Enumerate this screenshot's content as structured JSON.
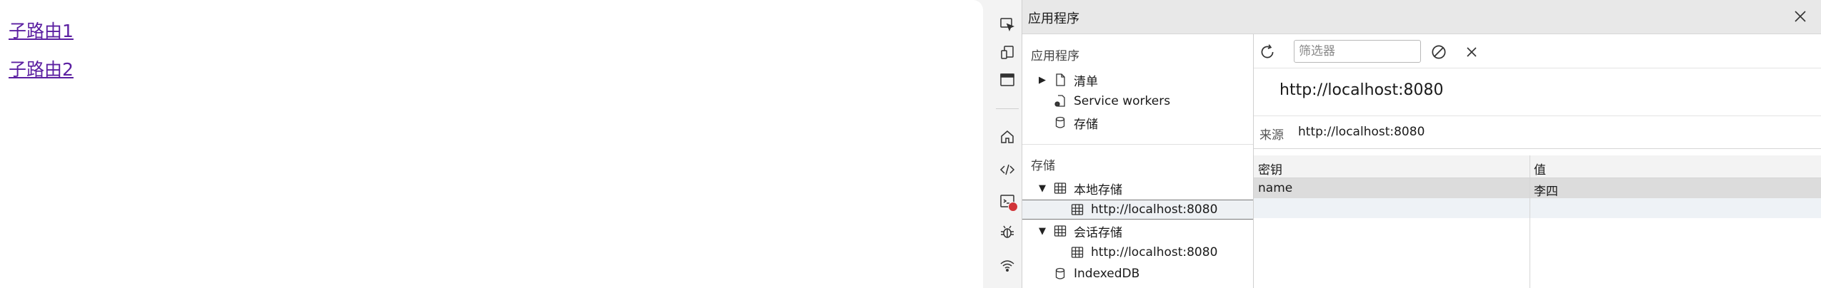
{
  "page": {
    "links": [
      "子路由1",
      "子路由2"
    ]
  },
  "devtools": {
    "title": "应用程序",
    "tree": {
      "app_section": "应用程序",
      "app_items": [
        {
          "label": "清单",
          "icon": "document-icon",
          "expandable": true
        },
        {
          "label": "Service workers",
          "icon": "gear-document-icon",
          "expandable": false
        },
        {
          "label": "存储",
          "icon": "database-icon",
          "expandable": false
        }
      ],
      "storage_section": "存储",
      "local_storage": {
        "label": "本地存储",
        "child": "http://localhost:8080"
      },
      "session_storage": {
        "label": "会话存储",
        "child": "http://localhost:8080"
      },
      "indexeddb": "IndexedDB"
    },
    "toolbar": {
      "filter_placeholder": "筛选器",
      "filter_value": ""
    },
    "origin_title": "http://localhost:8080",
    "origin_label": "来源",
    "origin_value": "http://localhost:8080",
    "grid": {
      "columns": [
        "密钥",
        "值"
      ],
      "rows": [
        {
          "key": "name",
          "value": "李四"
        }
      ]
    }
  },
  "colors": {
    "link": "#5b1fa1",
    "badge": "#d13438",
    "header_bg": "#e8e8e8",
    "selected_row": "#dcdcdc"
  }
}
